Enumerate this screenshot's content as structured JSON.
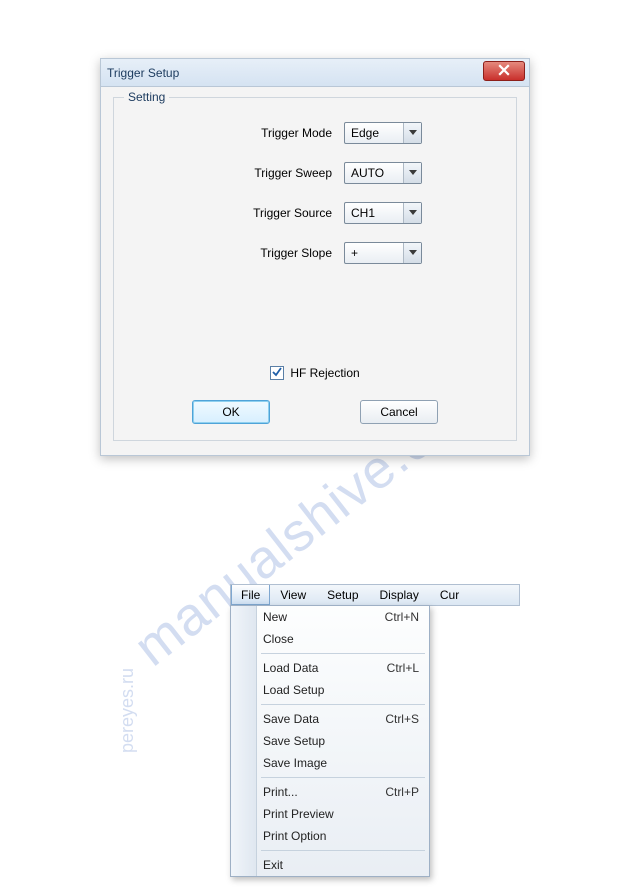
{
  "dialog": {
    "title": "Trigger Setup",
    "group_legend": "Setting",
    "fields": {
      "trigger_mode": {
        "label": "Trigger Mode",
        "value": "Edge"
      },
      "trigger_sweep": {
        "label": "Trigger Sweep",
        "value": "AUTO"
      },
      "trigger_source": {
        "label": "Trigger Source",
        "value": "CH1"
      },
      "trigger_slope": {
        "label": "Trigger Slope",
        "value": "+"
      }
    },
    "hf_rejection": {
      "label": "HF Rejection",
      "checked": true
    },
    "ok_label": "OK",
    "cancel_label": "Cancel"
  },
  "menubar": {
    "items": [
      "File",
      "View",
      "Setup",
      "Display",
      "Cur"
    ],
    "dropdown": [
      {
        "label": "New",
        "shortcut": "Ctrl+N"
      },
      {
        "label": "Close",
        "shortcut": ""
      },
      {
        "sep": true
      },
      {
        "label": "Load Data",
        "shortcut": "Ctrl+L"
      },
      {
        "label": "Load Setup",
        "shortcut": ""
      },
      {
        "sep": true
      },
      {
        "label": "Save Data",
        "shortcut": "Ctrl+S"
      },
      {
        "label": "Save Setup",
        "shortcut": ""
      },
      {
        "label": "Save Image",
        "shortcut": ""
      },
      {
        "sep": true
      },
      {
        "label": "Print...",
        "shortcut": "Ctrl+P"
      },
      {
        "label": "Print Preview",
        "shortcut": ""
      },
      {
        "label": "Print Option",
        "shortcut": ""
      },
      {
        "sep": true
      },
      {
        "label": "Exit",
        "shortcut": ""
      }
    ]
  },
  "watermark": {
    "main": "manualshive.com",
    "side": "pereyes.ru"
  }
}
